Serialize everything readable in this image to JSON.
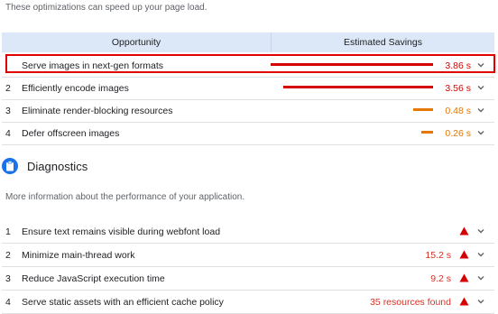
{
  "opportunities": {
    "intro": "These optimizations can speed up your page load.",
    "header": {
      "opportunity": "Opportunity",
      "savings": "Estimated Savings"
    },
    "rows": [
      {
        "num": "",
        "title": "Serve images in next-gen formats",
        "value": "3.86 s",
        "bar_level": 1.0,
        "color": "#d50000"
      },
      {
        "num": "2",
        "title": "Efficiently encode images",
        "value": "3.56 s",
        "bar_level": 0.92,
        "color": "#d50000"
      },
      {
        "num": "3",
        "title": "Eliminate render-blocking resources",
        "value": "0.48 s",
        "bar_level": 0.12,
        "color": "#e67700"
      },
      {
        "num": "4",
        "title": "Defer offscreen images",
        "value": "0.26 s",
        "bar_level": 0.07,
        "color": "#e67700"
      }
    ]
  },
  "diagnostics": {
    "title": "Diagnostics",
    "description": "More information about the performance of your application.",
    "rows": [
      {
        "num": "1",
        "title": "Ensure text remains visible during webfont load",
        "value": ""
      },
      {
        "num": "2",
        "title": "Minimize main-thread work",
        "value": "15.2 s"
      },
      {
        "num": "3",
        "title": "Reduce JavaScript execution time",
        "value": "9.2 s"
      },
      {
        "num": "4",
        "title": "Serve static assets with an efficient cache policy",
        "value": "35 resources found"
      }
    ]
  },
  "colors": {
    "fail": "#d50000",
    "average": "#e67700",
    "accent": "#1a73e8",
    "header_bg": "#dce8f7"
  },
  "icons": {
    "diagnostics": "clipboard-icon",
    "warning": "warning-triangle-icon",
    "expand": "chevron-down-icon"
  }
}
